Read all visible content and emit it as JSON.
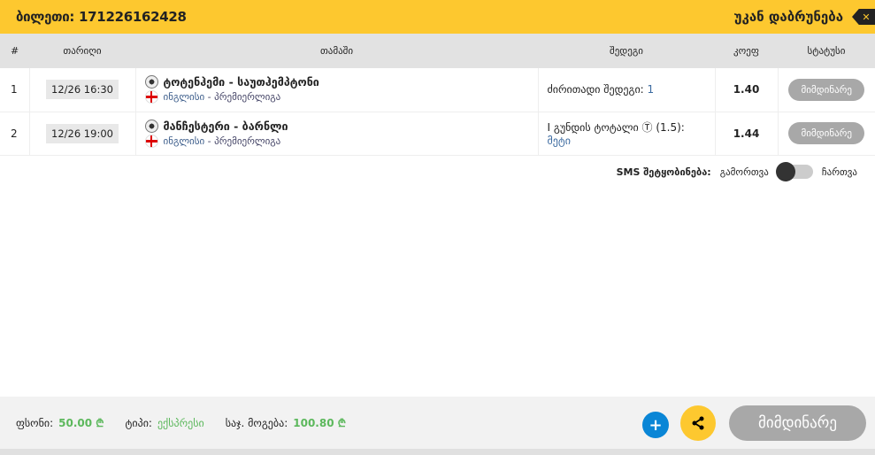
{
  "header": {
    "ticket_label": "ბილეთი: 171226162428",
    "back_label": "უკან დაბრუნება"
  },
  "columns": [
    "#",
    "თარიღი",
    "თამაში",
    "შედეგი",
    "კოეფ",
    "სტატუსი"
  ],
  "rows": [
    {
      "num": "1",
      "date": "12/26 16:30",
      "game": "ტოტენჰემი - საუთჰემპტონი",
      "country": "ინგლისი",
      "league": " - პრემიერლიგა",
      "result_label": "ძირითადი შედეგი: ",
      "result_value": "1",
      "odds": "1.40",
      "status": "მიმდინარე"
    },
    {
      "num": "2",
      "date": "12/26 19:00",
      "game": "მანჩესტერი - ბარნლი",
      "country": "ინგლისი",
      "league": " - პრემიერლიგა",
      "result_label": "I გუნდის ტოტალი Ⓣ (1.5): ",
      "result_value": "მეტი",
      "odds": "1.44",
      "status": "მიმდინარე"
    }
  ],
  "sms": {
    "label": "SMS შეტყობინება:",
    "off": "გამორთვა",
    "on": "ჩართვა",
    "enabled": false
  },
  "footer": {
    "stake_label": "ფსონი:",
    "stake": "50.00 ₾",
    "type_label": "ტიპი:",
    "type": "ექსპრესი",
    "win_label": "საჯ. მოგება:",
    "win": "100.80 ₾",
    "plus": "+",
    "status_button": "მიმდინარე"
  }
}
